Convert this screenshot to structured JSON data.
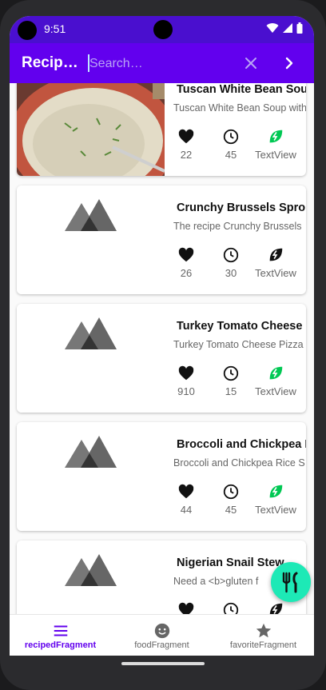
{
  "status_bar": {
    "time": "9:51",
    "icons": [
      "wifi-icon",
      "signal-icon",
      "battery-icon"
    ]
  },
  "app_bar": {
    "title": "Recip…",
    "search_placeholder": "Search…",
    "clear_icon": "close-icon",
    "submit_icon": "chevron-right-icon"
  },
  "recipes": [
    {
      "title": "Tuscan White Bean Soup",
      "description": "Tuscan White Bean Soup with",
      "likes": "22",
      "minutes": "45",
      "vegan_label": "TextView",
      "vegan": true,
      "image": "bean-soup-photo"
    },
    {
      "title": "Crunchy Brussels Sprout",
      "description": "The recipe Crunchy Brussels",
      "likes": "26",
      "minutes": "30",
      "vegan_label": "TextView",
      "vegan": false,
      "image": "placeholder-image-icon"
    },
    {
      "title": "Turkey Tomato Cheese P",
      "description": "Turkey Tomato Cheese Pizza",
      "likes": "910",
      "minutes": "15",
      "vegan_label": "TextView",
      "vegan": true,
      "image": "placeholder-image-icon"
    },
    {
      "title": "Broccoli and Chickpea R",
      "description": "Broccoli and Chickpea Rice S",
      "likes": "44",
      "minutes": "45",
      "vegan_label": "TextView",
      "vegan": true,
      "image": "placeholder-image-icon"
    },
    {
      "title": "Nigerian Snail Stew",
      "description": "Need a <b>gluten f",
      "likes": "",
      "minutes": "",
      "vegan_label": "",
      "vegan": false,
      "image": "placeholder-image-icon"
    }
  ],
  "fab": {
    "icon": "restaurant-icon"
  },
  "bottom_nav": [
    {
      "label": "recipedFragment",
      "icon": "menu-icon",
      "active": true
    },
    {
      "label": "foodFragment",
      "icon": "smiley-icon",
      "active": false
    },
    {
      "label": "favoriteFragment",
      "icon": "star-icon",
      "active": false
    }
  ],
  "colors": {
    "status_bar": "#4a0fcf",
    "app_bar": "#6200ee",
    "accent": "#1de9b6",
    "vegan_active": "#00c853",
    "heart": "#111111"
  }
}
